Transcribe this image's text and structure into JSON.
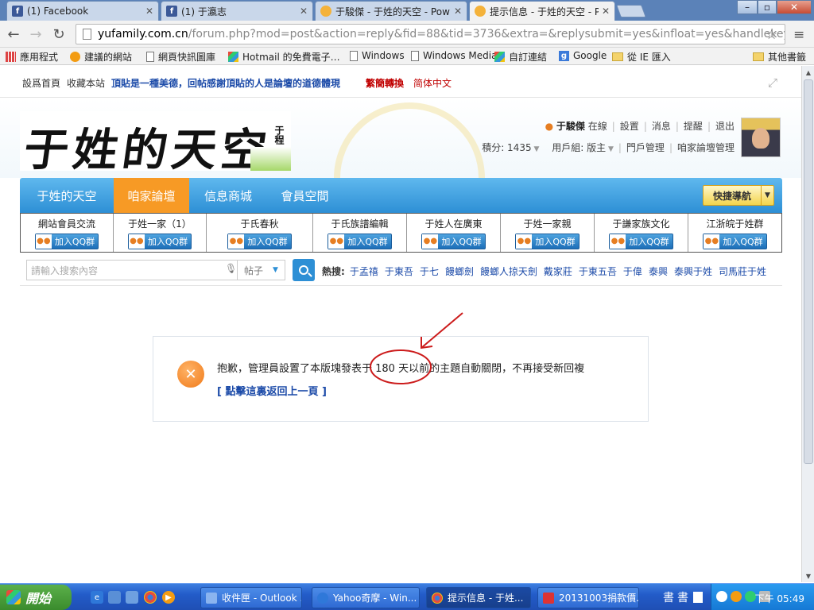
{
  "browser": {
    "tabs": [
      {
        "title": "(1) Facebook",
        "icon": "facebook-icon"
      },
      {
        "title": "(1) 于瀛志",
        "icon": "facebook-icon"
      },
      {
        "title": "于駿傑 - 于姓的天空 - Pow",
        "icon": "discuz-icon"
      },
      {
        "title": "提示信息 - 于姓的天空 - Po",
        "icon": "discuz-icon",
        "active": true
      }
    ],
    "window_buttons": {
      "minimize": "–",
      "maximize": "▫",
      "close": "✕"
    },
    "url_host": "yufamily.com.cn",
    "url_path": "/forum.php?mod=post&action=reply&fid=88&tid=3736&extra=&replysubmit=yes&infloat=yes&handlekey=fastpost",
    "bookmarks": [
      {
        "label": "應用程式",
        "icon": "apps-icon"
      },
      {
        "label": "建議的網站",
        "icon": "bulb-icon"
      },
      {
        "label": "網頁快訊圖庫",
        "icon": "page-icon"
      },
      {
        "label": "Hotmail 的免費電子…",
        "icon": "windows-icon"
      },
      {
        "label": "Windows",
        "icon": "page-icon"
      },
      {
        "label": "Windows Media",
        "icon": "page-icon"
      },
      {
        "label": "自訂連結",
        "icon": "windows-icon"
      },
      {
        "label": "Google",
        "icon": "google-icon"
      },
      {
        "label": "從 IE 匯入",
        "icon": "folder-icon"
      },
      {
        "label": "其他書籤",
        "icon": "folder-icon"
      }
    ]
  },
  "site": {
    "topbar": {
      "set_home": "設爲首頁",
      "bookmark": "收藏本站",
      "slogan": "頂貼是一種美德，回帖感謝頂貼的人是論壇的道德體現",
      "trad": "繁簡轉換",
      "simp": "简体中文"
    },
    "logo_text": "于姓的天空",
    "logo_small": "于程",
    "user": {
      "name": "于駿傑",
      "status": "在線",
      "links": [
        "設置",
        "消息",
        "提醒",
        "退出"
      ],
      "credits": "積分: 1435",
      "group": "用戶組: 版主",
      "portal": "門戶管理",
      "admin": "咱家論壇管理"
    },
    "nav": [
      {
        "label": "于姓的天空",
        "active": false
      },
      {
        "label": "咱家論壇",
        "active": true
      },
      {
        "label": "信息商城",
        "active": false
      },
      {
        "label": "會員空間",
        "active": false
      }
    ],
    "quick_nav": "快捷導航",
    "qq_label": "加入QQ群",
    "groups": [
      "網站會員交流",
      "于姓一家（1）",
      "于氏春秋",
      "于氏族譜編輯",
      "于姓人在廣東",
      "于姓一家親",
      "于謙家族文化",
      "江浙皖于姓群"
    ],
    "search": {
      "placeholder": "請輸入搜索內容",
      "type": "帖子",
      "hot_label": "熱搜:",
      "hot": [
        "于孟禧",
        "于東吾",
        "于七",
        "饅螂劍",
        "饅螂人掠天劍",
        "戴家莊",
        "于東五吾",
        "于偉",
        "泰興",
        "泰興于姓",
        "司馬莊于姓"
      ]
    },
    "message": {
      "text": "抱歉，管理員設置了本版塊發表于 180 天以前的主題自動關閉，不再接受新回複",
      "back_link": "[ 點擊這裏返回上一頁 ]"
    }
  },
  "taskbar": {
    "start": "開始",
    "tasks": [
      {
        "label": "收件匣 - Outlook ...",
        "icon": "outlook-icon"
      },
      {
        "label": "Yahoo奇摩 - Win...",
        "icon": "ie-icon"
      },
      {
        "label": "提示信息 - 于姓...",
        "icon": "chrome-icon",
        "active": true
      },
      {
        "label": "20131003捐款價...",
        "icon": "image-icon"
      }
    ],
    "ime": [
      "書",
      "書"
    ],
    "clock": "下午 05:49"
  },
  "colors": {
    "nav_blue": "#2d8fd5",
    "nav_active": "#f79a25",
    "link_blue": "#1b4aa8",
    "annotation_red": "#cc1b1b"
  }
}
